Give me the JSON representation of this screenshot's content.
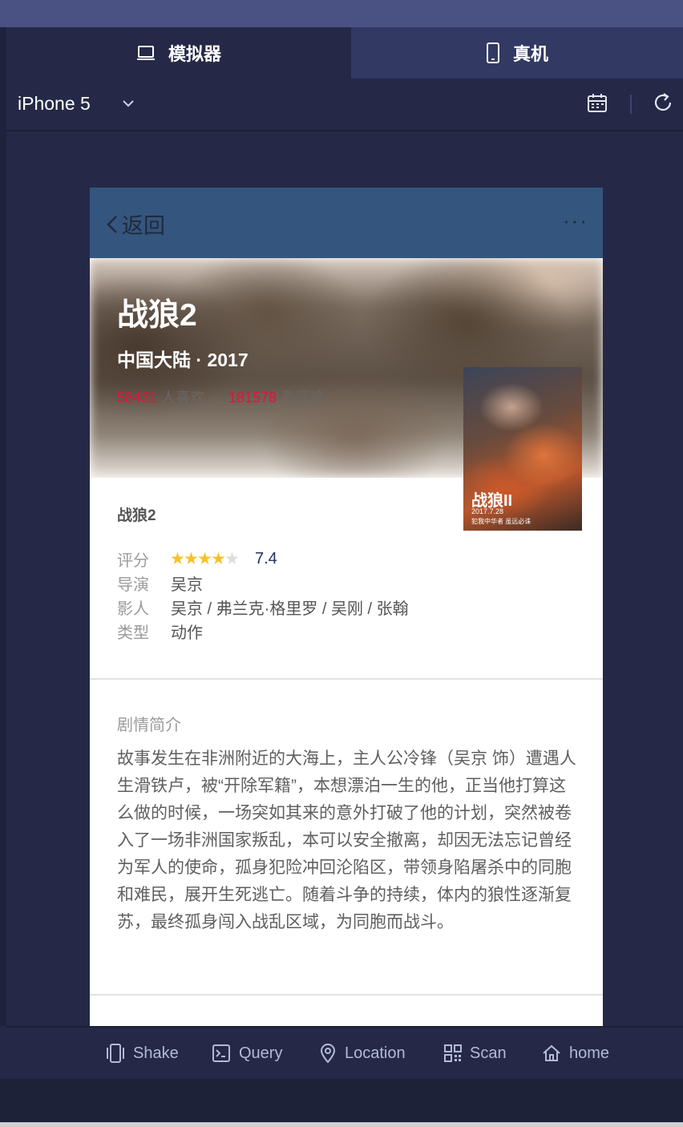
{
  "tabs": [
    {
      "label": "模拟器",
      "icon": "laptop-icon"
    },
    {
      "label": "真机",
      "icon": "phone-icon"
    }
  ],
  "device": {
    "name": "iPhone 5"
  },
  "nav": {
    "back_label": "返回",
    "more": "···"
  },
  "movie": {
    "title": "战狼2",
    "region_year": "中国大陆 · 2017",
    "likes": "58431",
    "likes_label": "人喜欢",
    "comments": "181578",
    "comments_label": "条评论",
    "poster_title": "战狼II",
    "poster_date": "2017.7.28",
    "poster_tagline": "犯我中华者 虽远必诛"
  },
  "info": {
    "name": "战狼2",
    "rating_label": "评分",
    "rating_value": "7.4",
    "rating_stars": 4,
    "director_label": "导演",
    "director": "吴京",
    "cast_label": "影人",
    "cast": "吴京 / 弗兰克·格里罗 / 吴刚 / 张翰",
    "genre_label": "类型",
    "genre": "动作"
  },
  "plot": {
    "heading": "剧情简介",
    "text": "故事发生在非洲附近的大海上，主人公冷锋（吴京 饰）遭遇人生滑铁卢，被“开除军籍”，本想漂泊一生的他，正当他打算这么做的时候，一场突如其来的意外打破了他的计划，突然被卷入了一场非洲国家叛乱，本可以安全撤离，却因无法忘记曾经为军人的使命，孤身犯险冲回沦陷区，带领身陷屠杀中的同胞和难民，展开生死逃亡。随着斗争的持续，体内的狼性逐渐复苏，最终孤身闯入战乱区域，为同胞而战斗。"
  },
  "toolbar": {
    "shake": "Shake",
    "query": "Query",
    "location": "Location",
    "scan": "Scan",
    "home": "home"
  },
  "colors": {
    "accent_red": "#e4133f",
    "navbar": "#34557d",
    "star": "#f6c12c",
    "background": "#252947"
  }
}
